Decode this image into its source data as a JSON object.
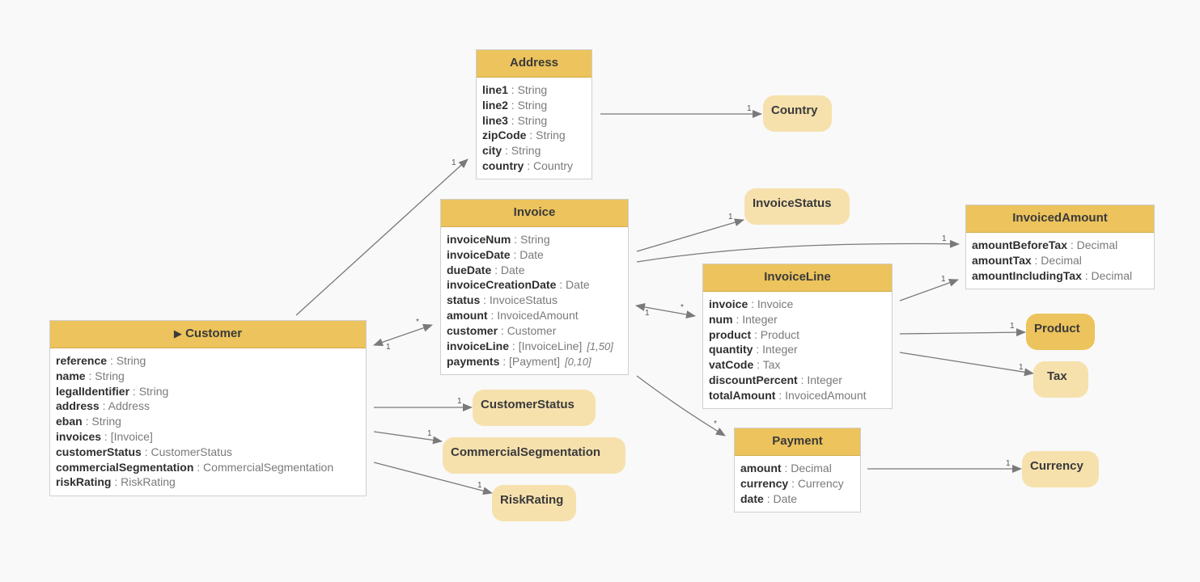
{
  "entities": {
    "address": {
      "title": "Address",
      "attrs": [
        {
          "name": "line1",
          "type": ": String"
        },
        {
          "name": "line2",
          "type": ": String"
        },
        {
          "name": "line3",
          "type": ": String"
        },
        {
          "name": "zipCode",
          "type": ": String"
        },
        {
          "name": "city",
          "type": ": String"
        },
        {
          "name": "country",
          "type": ": Country"
        }
      ]
    },
    "invoice": {
      "title": "Invoice",
      "attrs": [
        {
          "name": "invoiceNum",
          "type": ": String"
        },
        {
          "name": "invoiceDate",
          "type": ": Date"
        },
        {
          "name": "dueDate",
          "type": ": Date"
        },
        {
          "name": "invoiceCreationDate",
          "type": ": Date"
        },
        {
          "name": "status",
          "type": ": InvoiceStatus"
        },
        {
          "name": "amount",
          "type": ": InvoicedAmount"
        },
        {
          "name": "customer",
          "type": ": Customer"
        },
        {
          "name": "invoiceLine",
          "type": ": [InvoiceLine]",
          "mult": "[1,50]"
        },
        {
          "name": "payments",
          "type": ": [Payment]",
          "mult": "[0,10]"
        }
      ]
    },
    "customer": {
      "title": "Customer",
      "expand_icon": "▶",
      "attrs": [
        {
          "name": "reference",
          "type": ": String"
        },
        {
          "name": "name",
          "type": ": String"
        },
        {
          "name": "legalIdentifier",
          "type": ": String"
        },
        {
          "name": "address",
          "type": ": Address"
        },
        {
          "name": "eban",
          "type": ": String"
        },
        {
          "name": "invoices",
          "type": ": [Invoice]"
        },
        {
          "name": "customerStatus",
          "type": ": CustomerStatus"
        },
        {
          "name": "commercialSegmentation",
          "type": ": CommercialSegmentation"
        },
        {
          "name": "riskRating",
          "type": ": RiskRating"
        }
      ]
    },
    "invoiceLine": {
      "title": "InvoiceLine",
      "attrs": [
        {
          "name": "invoice",
          "type": ": Invoice"
        },
        {
          "name": "num",
          "type": ": Integer"
        },
        {
          "name": "product",
          "type": ": Product"
        },
        {
          "name": "quantity",
          "type": ": Integer"
        },
        {
          "name": "vatCode",
          "type": ": Tax"
        },
        {
          "name": "discountPercent",
          "type": ": Integer"
        },
        {
          "name": "totalAmount",
          "type": ": InvoicedAmount"
        }
      ]
    },
    "invoicedAmount": {
      "title": "InvoicedAmount",
      "attrs": [
        {
          "name": "amountBeforeTax",
          "type": ": Decimal"
        },
        {
          "name": "amountTax",
          "type": ": Decimal"
        },
        {
          "name": "amountIncludingTax",
          "type": ": Decimal"
        }
      ]
    },
    "payment": {
      "title": "Payment",
      "attrs": [
        {
          "name": "amount",
          "type": ": Decimal"
        },
        {
          "name": "currency",
          "type": ": Currency"
        },
        {
          "name": "date",
          "type": ": Date"
        }
      ]
    }
  },
  "refs": {
    "country": "Country",
    "invoiceStatus": "InvoiceStatus",
    "product": "Product",
    "tax": "Tax",
    "customerStatus": "CustomerStatus",
    "commercialSegmentation": "CommercialSegmentation",
    "riskRating": "RiskRating",
    "currency": "Currency"
  },
  "edges": [
    {
      "from": "Customer",
      "to": "Address",
      "label": "1"
    },
    {
      "from": "Address",
      "to": "Country",
      "label": "1"
    },
    {
      "from": "Customer",
      "to": "Invoice",
      "label_from": "1",
      "label_to": "*"
    },
    {
      "from": "Invoice",
      "to": "InvoiceStatus",
      "label": "1"
    },
    {
      "from": "Invoice",
      "to": "InvoicedAmount",
      "label": "1"
    },
    {
      "from": "Invoice",
      "to": "InvoiceLine",
      "label_from": "1",
      "label_to": "*"
    },
    {
      "from": "Invoice",
      "to": "Payment",
      "label": "*"
    },
    {
      "from": "InvoiceLine",
      "to": "InvoicedAmount",
      "label": "1"
    },
    {
      "from": "InvoiceLine",
      "to": "Product",
      "label": "1"
    },
    {
      "from": "InvoiceLine",
      "to": "Tax",
      "label": "1"
    },
    {
      "from": "Customer",
      "to": "CustomerStatus",
      "label": "1"
    },
    {
      "from": "Customer",
      "to": "CommercialSegmentation",
      "label": "1"
    },
    {
      "from": "Customer",
      "to": "RiskRating",
      "label": "1"
    },
    {
      "from": "Payment",
      "to": "Currency",
      "label": "1"
    }
  ]
}
